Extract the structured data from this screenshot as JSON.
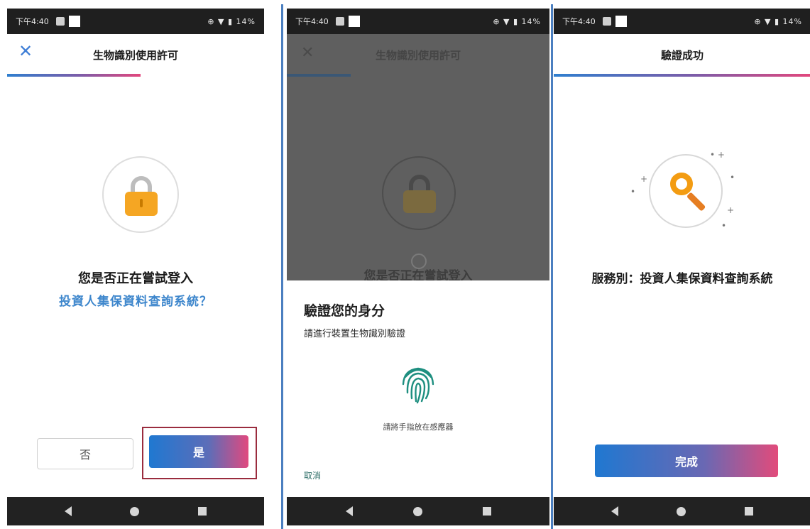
{
  "status_bar": {
    "time": "下午4:40",
    "indicators": "⊕ ▼ ▮ 14%"
  },
  "screen1": {
    "title": "生物識別使用許可",
    "question_line1": "您是否正在嘗試登入",
    "question_line2": "投資人集保資料查詢系統？",
    "no_label": "否",
    "yes_label": "是"
  },
  "screen2": {
    "background_title": "生物識別使用許可",
    "background_text": "您是否正在嘗試登入",
    "sheet_title": "驗證您的身分",
    "sheet_subtitle": "請進行裝置生物識別驗證",
    "fingerprint_hint": "請將手指放在感應器",
    "cancel_label": "取消"
  },
  "screen3": {
    "title": "驗證成功",
    "service_text": "服務別：投資人集保資料查詢系統",
    "done_label": "完成"
  },
  "icons": {
    "close": "close-icon",
    "lock": "lock-icon",
    "fingerprint": "fingerprint-icon",
    "key": "key-icon",
    "back": "back-icon",
    "home": "home-icon",
    "recents": "recents-icon"
  },
  "colors": {
    "accent_blue": "#1f78d1",
    "accent_pink": "#e2477d",
    "link_blue": "#3d86cc",
    "lock_orange": "#f5a623",
    "fingerprint_green": "#1e8f80"
  }
}
